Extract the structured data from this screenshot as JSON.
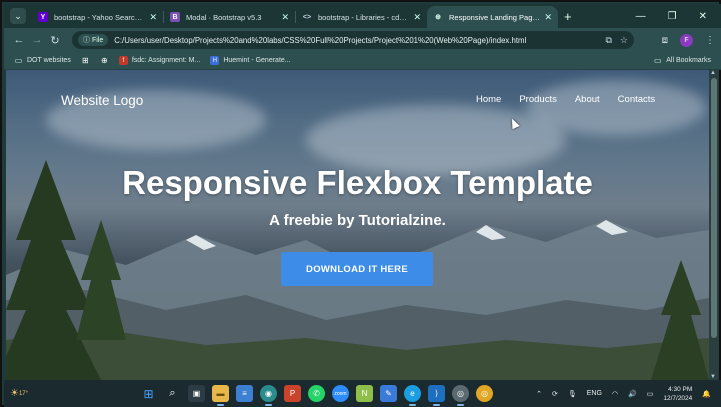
{
  "browser": {
    "tabs": [
      {
        "title": "bootstrap - Yahoo Search Resu",
        "favicon": "Y",
        "favicon_color": "#6001d2",
        "active": false
      },
      {
        "title": "Modal · Bootstrap v5.3",
        "favicon": "B",
        "favicon_color": "#7952b3",
        "active": false
      },
      {
        "title": "bootstrap - Libraries - cdnjs - T",
        "favicon": "<>",
        "favicon_color": "#2e4f4f",
        "active": false
      },
      {
        "title": "Responsive Landing Page Temp",
        "favicon": "⊕",
        "favicon_color": "#2e4f4f",
        "active": true
      }
    ],
    "new_tab": "+",
    "window_controls": {
      "minimize": "—",
      "restore": "❐",
      "close": "✕"
    },
    "address": {
      "scheme_chip": "File",
      "url": "C:/Users/user/Desktop/Projects%20and%20labs/CSS%20Full%20Projects/Project%201%20(Web%20Page)/index.html"
    },
    "profile_initial": "F",
    "bookmarks": [
      {
        "label": "DOT websites",
        "icon": "folder-icon"
      },
      {
        "label": "",
        "icon": "apps-grid-icon"
      },
      {
        "label": "",
        "icon": "globe-icon"
      },
      {
        "label": "fsdc: Assignment: M...",
        "icon": "fsdc-icon"
      },
      {
        "label": "Huemint - Generate...",
        "icon": "huemint-icon"
      }
    ],
    "all_bookmarks": "All Bookmarks"
  },
  "page": {
    "logo": "Website Logo",
    "nav": [
      "Home",
      "Products",
      "About",
      "Contacts"
    ],
    "hero_title": "Responsive Flexbox Template",
    "hero_subtitle": "A freebie by Tutorialzine.",
    "cta_label": "DOWNLOAD IT HERE"
  },
  "taskbar": {
    "weather_temp": "17°",
    "lang": "ENG",
    "time": "4:30 PM",
    "date": "12/7/2024"
  },
  "colors": {
    "cta": "#3d8ce8",
    "browser_chrome": "#2e4f4f"
  }
}
